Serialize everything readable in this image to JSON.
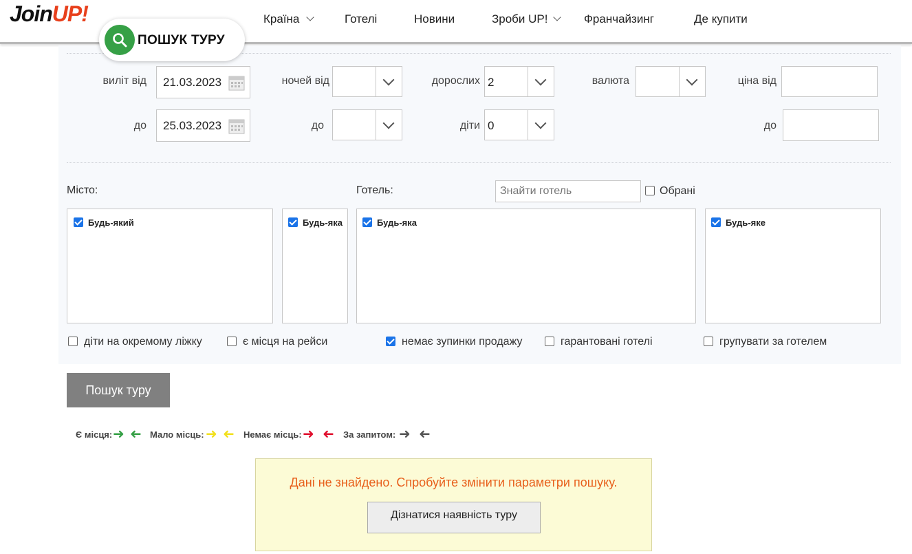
{
  "header": {
    "logo": {
      "join": "Join",
      "up": "UP!"
    },
    "nav": [
      {
        "label": "Країна",
        "dropdown": true
      },
      {
        "label": "Готелі",
        "dropdown": false
      },
      {
        "label": "Новини",
        "dropdown": false
      },
      {
        "label": "Зроби UP!",
        "dropdown": true
      },
      {
        "label": "Франчайзинг",
        "dropdown": false
      },
      {
        "label": "Де купити",
        "dropdown": false
      }
    ],
    "search_pill": "ПОШУК ТУРУ"
  },
  "filters": {
    "departure_from_label": "виліт від",
    "departure_from": "21.03.2023",
    "departure_to_label": "до",
    "departure_to": "25.03.2023",
    "nights_from_label": "ночей від",
    "nights_from": "",
    "nights_to_label": "до",
    "nights_to": "",
    "adults_label": "дорослих",
    "adults": "2",
    "children_label": "діти",
    "children": "0",
    "currency_label": "валюта",
    "currency": "",
    "price_from_label": "ціна від",
    "price_to_label": "до"
  },
  "lists": {
    "city_label": "Місто:",
    "hotel_label": "Готель:",
    "hotel_search_placeholder": "Знайти готель",
    "favorites_label": "Обрані",
    "city_any": "Будь-який",
    "category_any": "Будь-яка",
    "hotel_any": "Будь-яка",
    "meal_any": "Будь-яке"
  },
  "options": {
    "separate_bed": "діти на окремому ліжку",
    "seats_on_flights": "є місця на рейси",
    "no_stop_sale": "немає зупинки продажу",
    "guaranteed_hotels": "гарантовані готелі",
    "group_by_hotel": "групувати за готелем"
  },
  "search_button": "Пошук туру",
  "legend": {
    "available": "Є місця:",
    "few": "Мало місць:",
    "none": "Немає місць:",
    "request": "За запитом:",
    "colors": {
      "available": "#36a046",
      "few": "#f2e01e",
      "none": "#e0102e",
      "request": "#555555"
    }
  },
  "notice": {
    "message": "Дані не знайдено. Спробуйте змінити параметри пошуку.",
    "button": "Дізнатися наявність туру"
  },
  "colors": {
    "accent": "#36a046",
    "brand": "#e8401c",
    "notice_text": "#e8601c"
  }
}
